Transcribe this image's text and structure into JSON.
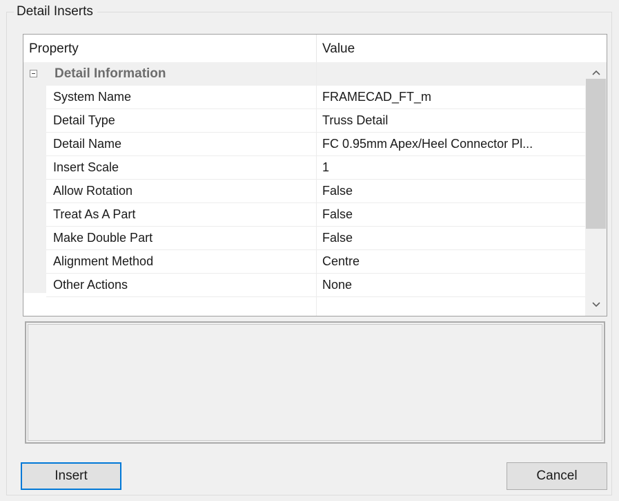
{
  "group": {
    "title": "Detail Inserts"
  },
  "grid": {
    "header": {
      "property": "Property",
      "value": "Value"
    },
    "category": {
      "label": "Detail Information"
    },
    "rows": [
      {
        "name": "System Name",
        "value": "FRAMECAD_FT_m"
      },
      {
        "name": "Detail Type",
        "value": "Truss Detail"
      },
      {
        "name": "Detail Name",
        "value": "FC 0.95mm Apex/Heel Connector Pl..."
      },
      {
        "name": "Insert Scale",
        "value": "1"
      },
      {
        "name": "Allow Rotation",
        "value": "False"
      },
      {
        "name": "Treat As A Part",
        "value": "False"
      },
      {
        "name": "Make Double Part",
        "value": "False"
      },
      {
        "name": "Alignment Method",
        "value": "Centre"
      },
      {
        "name": "Other Actions",
        "value": "None"
      }
    ],
    "scrollbar": {
      "up_icon": "chevron-up-icon",
      "down_icon": "chevron-down-icon"
    }
  },
  "buttons": {
    "insert": "Insert",
    "cancel": "Cancel"
  },
  "colors": {
    "window_bg": "#f0f0f0",
    "grid_bg": "#ffffff",
    "category_text": "#6d6d6d",
    "focus_border": "#0078d7"
  }
}
